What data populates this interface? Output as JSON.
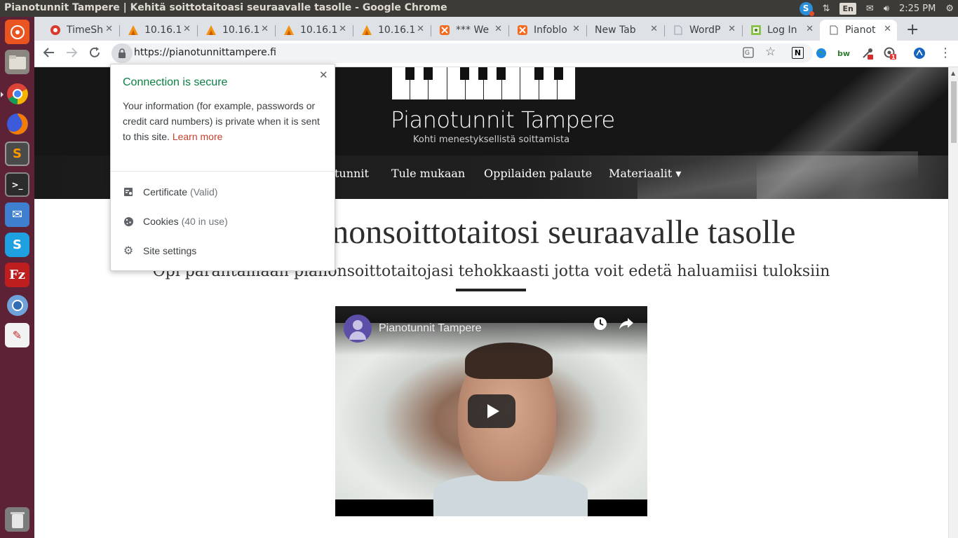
{
  "system_bar": {
    "window_title": "Pianotunnit Tampere | Kehitä soittotaitoasi seuraavalle tasolle - Google Chrome",
    "language": "En",
    "clock": "2:25 PM"
  },
  "launcher": {
    "items": [
      "dash",
      "files",
      "chrome",
      "firefox",
      "sublime-text",
      "terminal",
      "thunderbird",
      "skype",
      "filezilla",
      "chromium",
      "document-viewer",
      "trash"
    ]
  },
  "tabs": [
    {
      "label": "TimeSh",
      "icon": "timesheet-icon"
    },
    {
      "label": "10.16.1",
      "icon": "server-icon"
    },
    {
      "label": "10.16.1",
      "icon": "server-icon"
    },
    {
      "label": "10.16.1",
      "icon": "server-icon"
    },
    {
      "label": "10.16.1",
      "icon": "server-icon"
    },
    {
      "label": "*** We",
      "icon": "infoblox-icon"
    },
    {
      "label": "Infoblo",
      "icon": "infoblox-icon"
    },
    {
      "label": "New Tab",
      "icon": ""
    },
    {
      "label": "WordP",
      "icon": "page-icon"
    },
    {
      "label": "Log In",
      "icon": "login-icon"
    },
    {
      "label": "Pianot",
      "icon": "page-icon",
      "active": true
    }
  ],
  "toolbar": {
    "url": "https://pianotunnittampere.fi",
    "extensions": [
      "N",
      "bw"
    ],
    "badge_count": "1"
  },
  "site": {
    "brand": "Pianotunnit Tampere",
    "tagline": "Kohti menestyksellistä soittamista",
    "nav": {
      "partial_item": "tunnit",
      "items": [
        "Tule mukaan",
        "Oppilaiden palaute",
        "Materiaalit ▾"
      ]
    },
    "headline": "Kehitä pianonsoittotaitosi seuraavalle tasolle",
    "subheadline": "Opi parantamaan pianonsoittotaitojasi tehokkaasti jotta voit edetä haluamiisi tuloksiin",
    "video": {
      "channel_title": "Pianotunnit Tampere"
    }
  },
  "security_popup": {
    "title": "Connection is secure",
    "body": "Your information (for example, passwords or credit card numbers) is private when it is sent to this site.",
    "learn_more": "Learn more",
    "rows": [
      {
        "label": "Certificate",
        "note": "(Valid)",
        "icon": "certificate-icon"
      },
      {
        "label": "Cookies",
        "note": "(40 in use)",
        "icon": "cookie-icon"
      },
      {
        "label": "Site settings",
        "note": "",
        "icon": "gear-icon"
      }
    ]
  },
  "colors": {
    "launcher_bg": "#5e2237",
    "secure_green": "#0b8043",
    "link_red": "#c5412f",
    "tabstrip_bg": "#dee1e6"
  }
}
